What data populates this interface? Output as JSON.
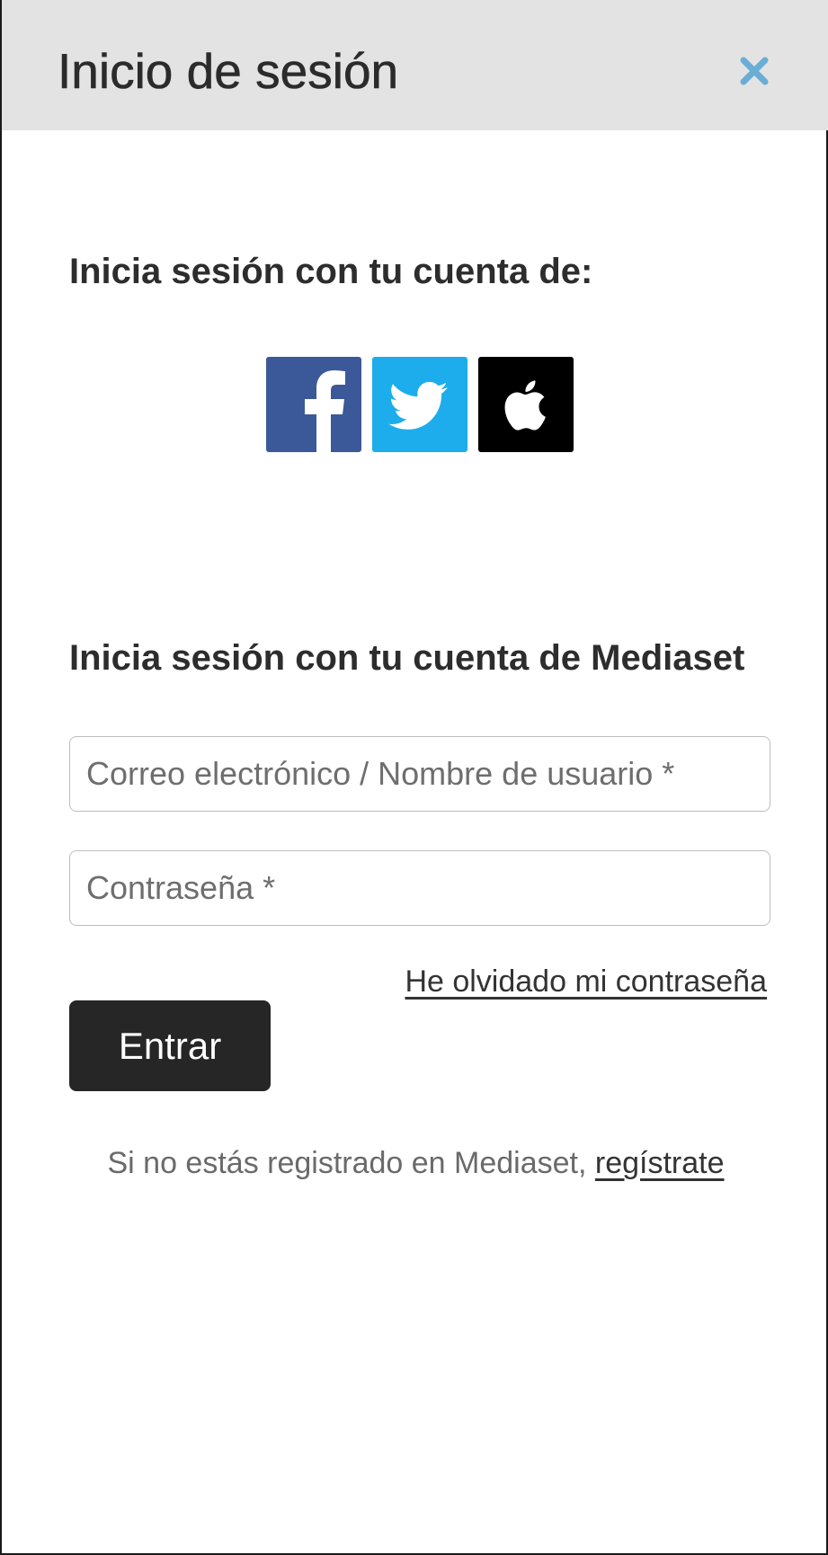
{
  "header": {
    "title": "Inicio de sesión",
    "close_icon": "close-icon",
    "close_color": "#6aaed6",
    "background": "#e3e3e4"
  },
  "social": {
    "title": "Inicia sesión con tu cuenta de:",
    "providers": [
      {
        "name": "Facebook",
        "icon": "facebook-icon",
        "color": "#3b5998"
      },
      {
        "name": "Twitter",
        "icon": "twitter-icon",
        "color": "#1dadec"
      },
      {
        "name": "Apple",
        "icon": "apple-icon",
        "color": "#000000"
      }
    ]
  },
  "mediaset": {
    "title": "Inicia sesión con tu cuenta de Mediaset",
    "email_placeholder": "Correo electrónico / Nombre de usuario *",
    "email_value": "",
    "password_placeholder": "Contraseña *",
    "password_value": "",
    "forgot_label": "He olvidado mi contraseña",
    "submit_label": "Entrar",
    "submit_color": "#262626"
  },
  "register": {
    "prefix": "Si no estás registrado en Mediaset, ",
    "link_label": "regístrate"
  }
}
